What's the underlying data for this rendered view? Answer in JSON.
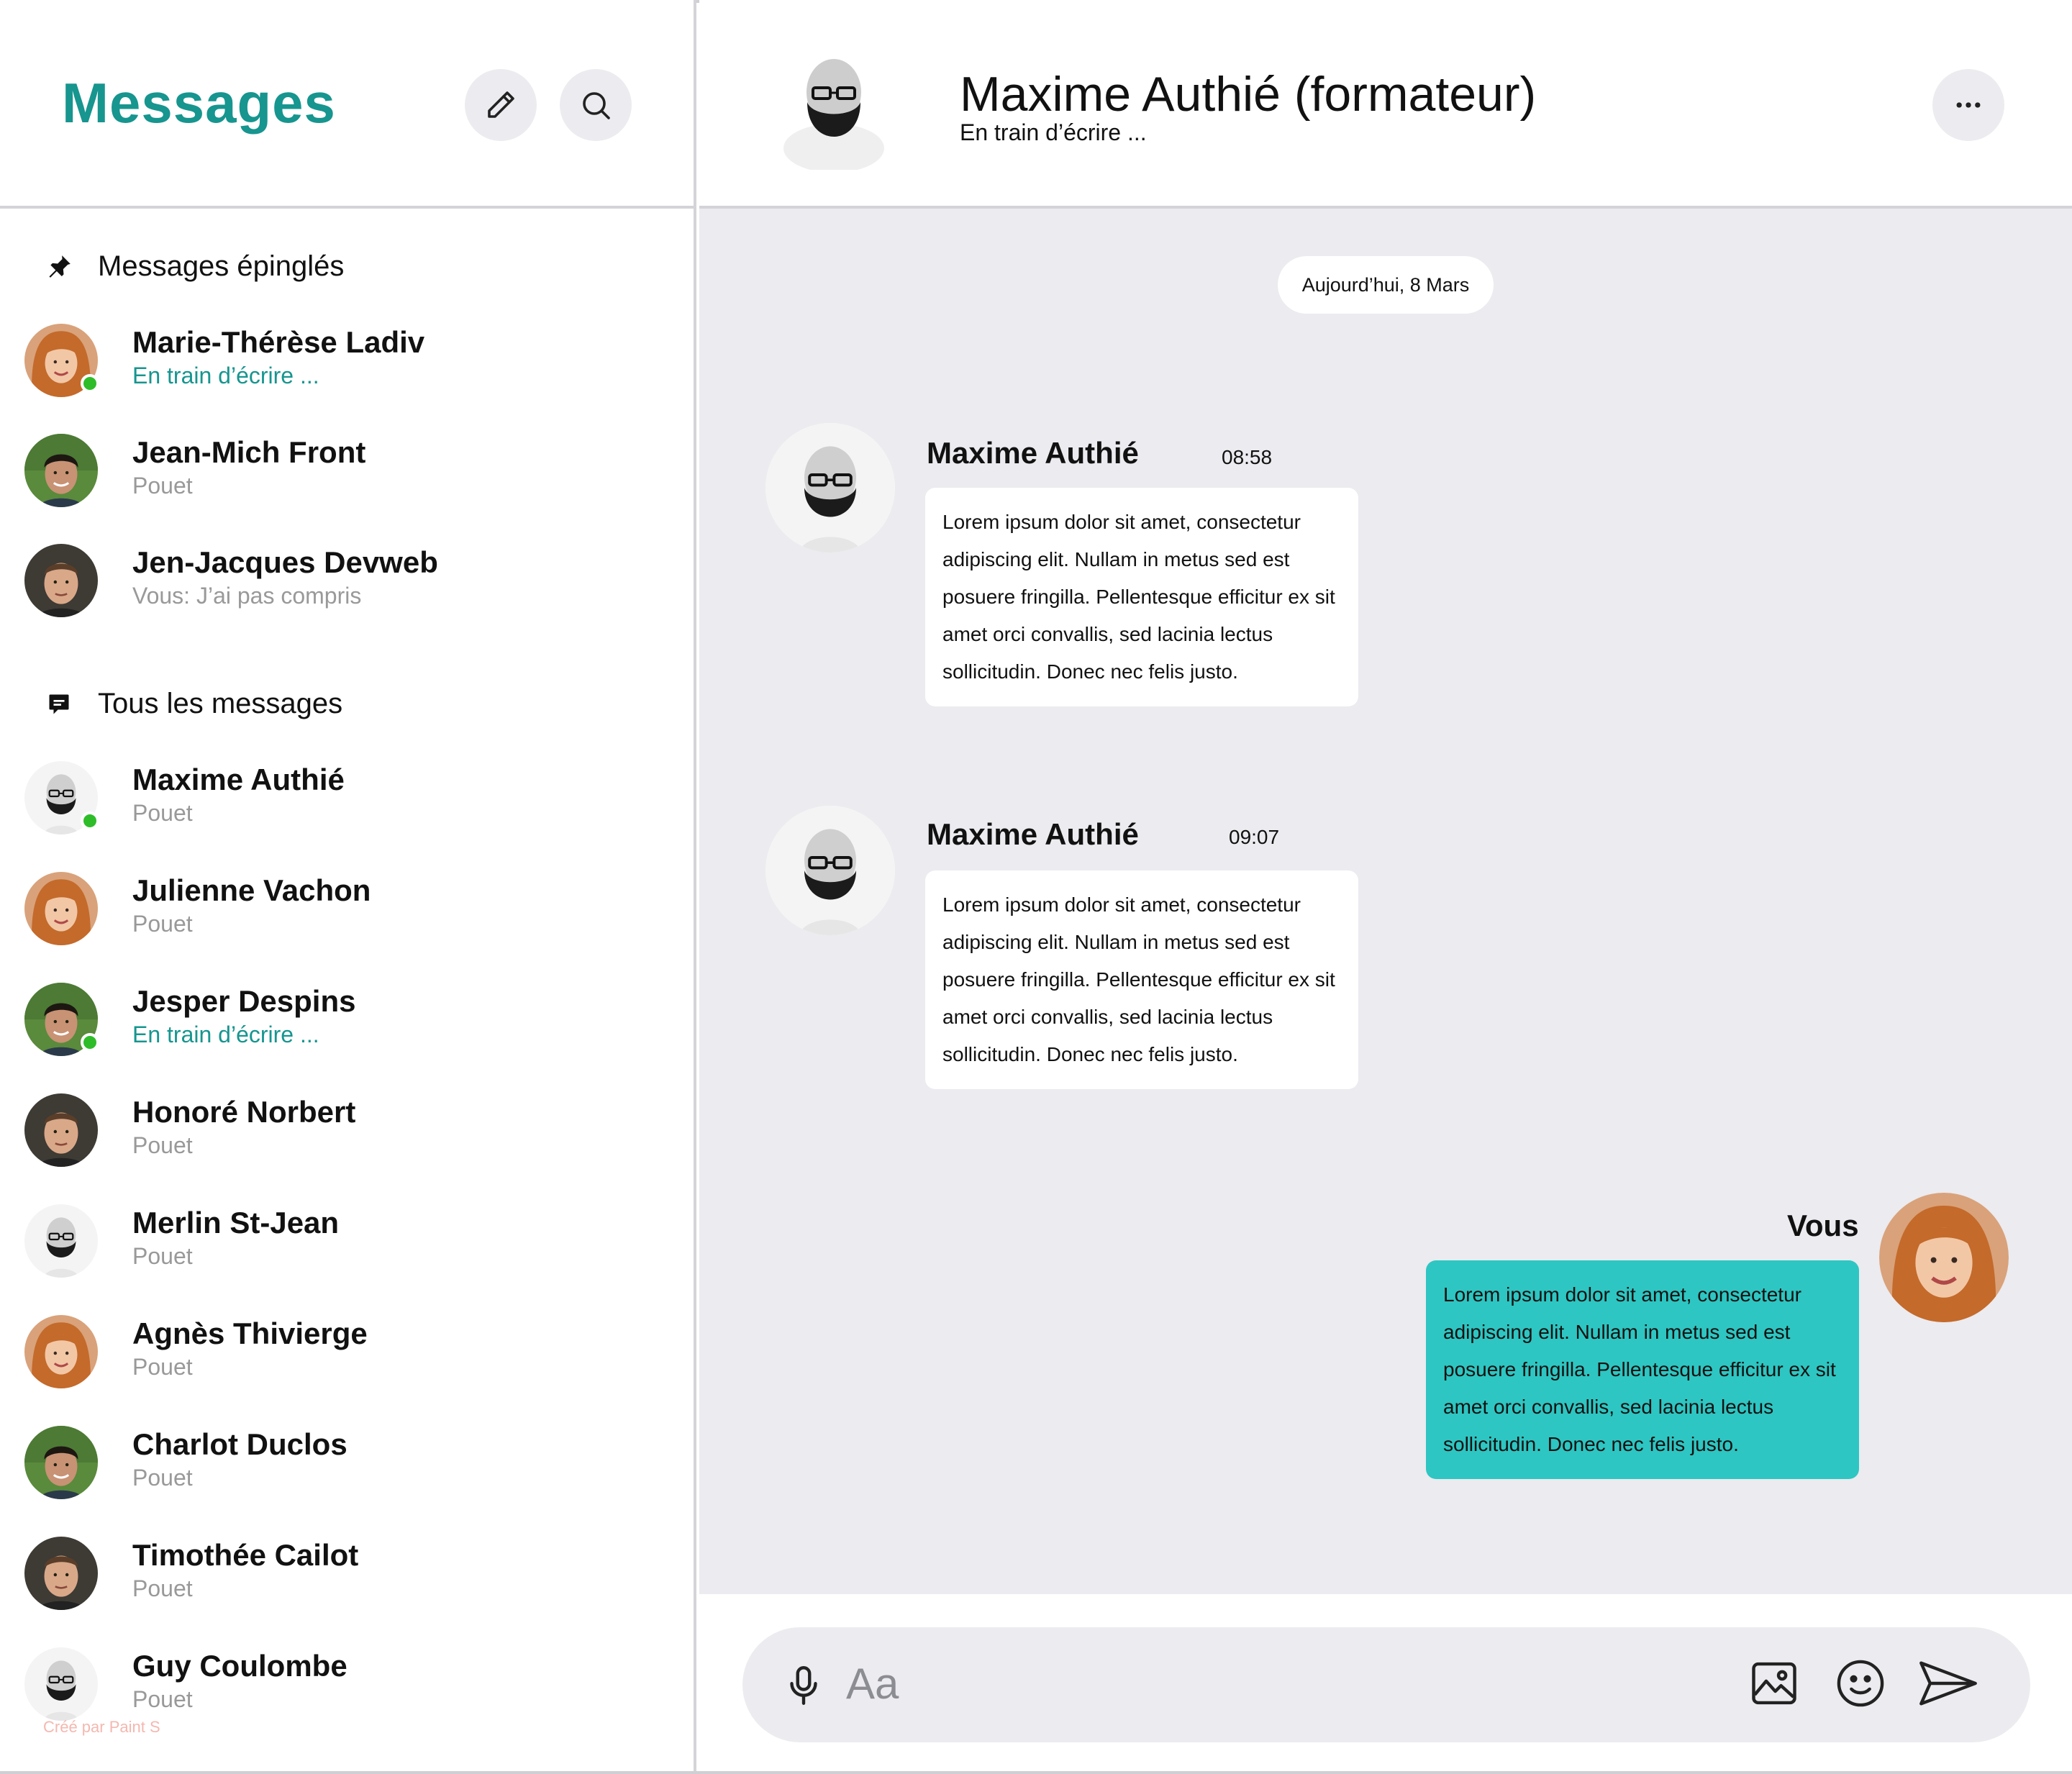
{
  "sidebar": {
    "title": "Messages",
    "pinned_section_label": "Messages épinglés",
    "all_section_label": "Tous les messages",
    "pinned": [
      {
        "name": "Marie-Thérèse Ladiv",
        "sub": "En train d’écrire ...",
        "typing": true,
        "online": true,
        "avatar": "woman"
      },
      {
        "name": "Jean-Mich Front",
        "sub": "Pouet",
        "typing": false,
        "online": false,
        "avatar": "young-man"
      },
      {
        "name": "Jen-Jacques Devweb",
        "sub": "Vous: J’ai pas compris",
        "typing": false,
        "online": false,
        "avatar": "man"
      }
    ],
    "all": [
      {
        "name": "Maxime Authié",
        "sub": "Pouet",
        "typing": false,
        "online": true,
        "avatar": "bearded"
      },
      {
        "name": "Julienne Vachon",
        "sub": "Pouet",
        "typing": false,
        "online": false,
        "avatar": "woman"
      },
      {
        "name": "Jesper Despins",
        "sub": "En train d’écrire ...",
        "typing": true,
        "online": true,
        "avatar": "young-man"
      },
      {
        "name": "Honoré Norbert",
        "sub": "Pouet",
        "typing": false,
        "online": false,
        "avatar": "man"
      },
      {
        "name": "Merlin St-Jean",
        "sub": "Pouet",
        "typing": false,
        "online": false,
        "avatar": "bearded"
      },
      {
        "name": "Agnès Thivierge",
        "sub": "Pouet",
        "typing": false,
        "online": false,
        "avatar": "woman"
      },
      {
        "name": "Charlot Duclos",
        "sub": "Pouet",
        "typing": false,
        "online": false,
        "avatar": "young-man"
      },
      {
        "name": "Timothée Cailot",
        "sub": "Pouet",
        "typing": false,
        "online": false,
        "avatar": "man"
      },
      {
        "name": "Guy Coulombe",
        "sub": "Pouet",
        "typing": false,
        "online": false,
        "avatar": "bearded"
      }
    ],
    "watermark": "Créé par Paint S"
  },
  "chat": {
    "title": "Maxime Authié (formateur)",
    "status": "En train d’écrire ...",
    "date_label": "Aujourd’hui, 8 Mars",
    "messages": [
      {
        "author": "Maxime Authié",
        "time": "08:58",
        "text": "Lorem ipsum dolor sit amet, consectetur adipiscing elit. Nullam in metus sed est posuere fringilla. Pellentesque efficitur ex sit amet orci convallis, sed lacinia lectus sollicitudin. Donec nec felis justo."
      },
      {
        "author": "Maxime Authié",
        "time": "09:07",
        "text": "Lorem ipsum dolor sit amet, consectetur adipiscing elit. Nullam in metus sed est posuere fringilla. Pellentesque efficitur ex sit amet orci convallis, sed lacinia lectus sollicitudin. Donec nec felis justo."
      },
      {
        "author": "Vous",
        "time": "",
        "text": "Lorem ipsum dolor sit amet, consectetur adipiscing elit. Nullam in metus sed est posuere fringilla. Pellentesque efficitur ex sit amet orci convallis, sed lacinia lectus sollicitudin. Donec nec felis justo."
      }
    ]
  },
  "composer": {
    "placeholder": "Aa"
  },
  "colors": {
    "accent": "#17958f",
    "own_bubble": "#2ec6c2",
    "online": "#2ebd29",
    "chat_bg": "#ebebf0",
    "button_bg": "#ececf0"
  },
  "icons": {
    "compose": "pencil-icon",
    "search": "search-icon",
    "more": "more-horizontal-icon",
    "pin": "pin-icon",
    "messages": "chat-bubble-icon",
    "mic": "microphone-icon",
    "image": "image-icon",
    "emoji": "emoji-icon",
    "send": "send-icon"
  }
}
